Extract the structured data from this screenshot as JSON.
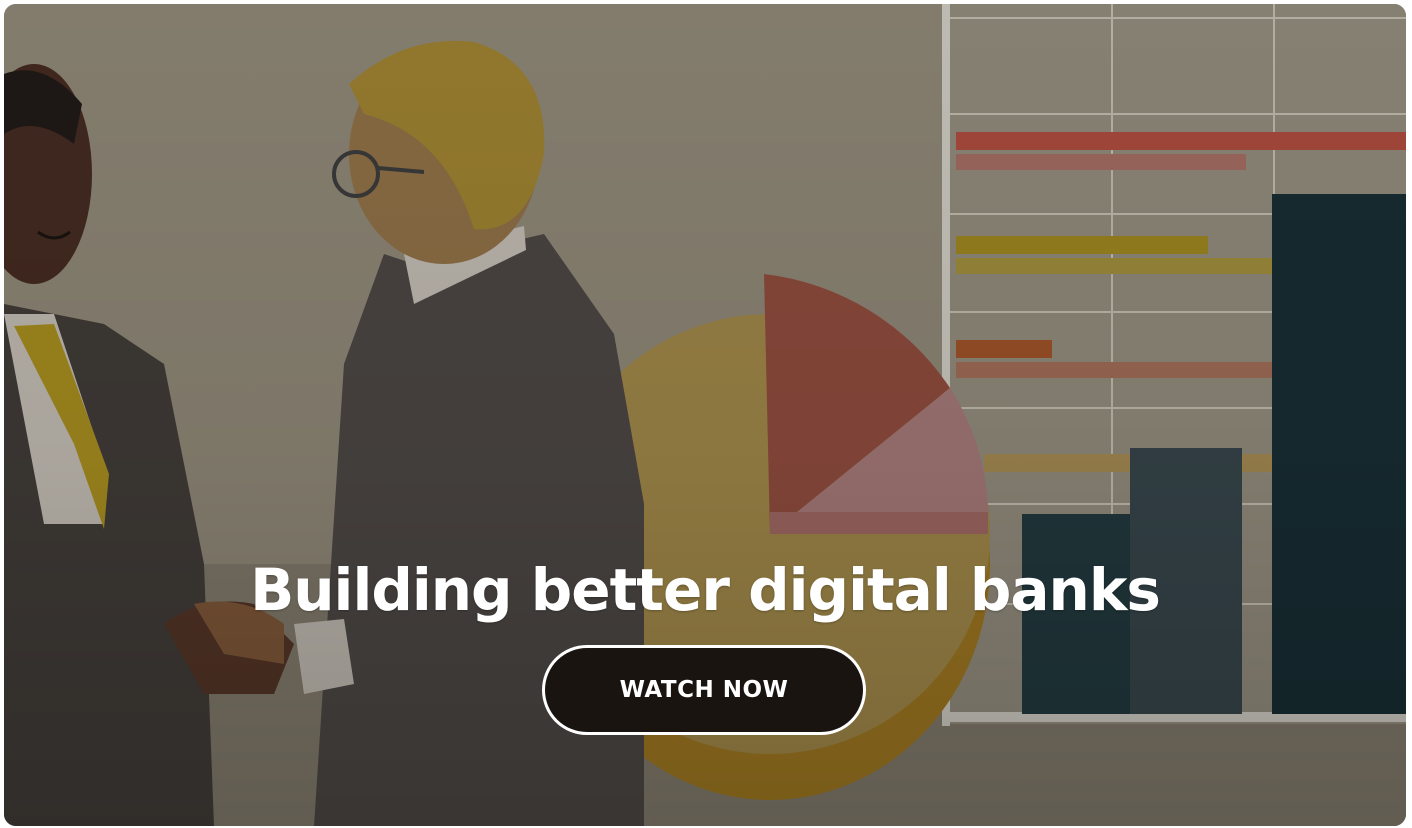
{
  "hero": {
    "headline": "Building better digital banks",
    "cta_label": "WATCH NOW",
    "image_subject": "illustration-two-businessmen-handshake-with-charts"
  },
  "colors": {
    "background": "#8a8272",
    "headline": "#ffffff",
    "button_fill": "#1a1410",
    "button_border": "#ffffff",
    "button_text": "#ffffff"
  }
}
